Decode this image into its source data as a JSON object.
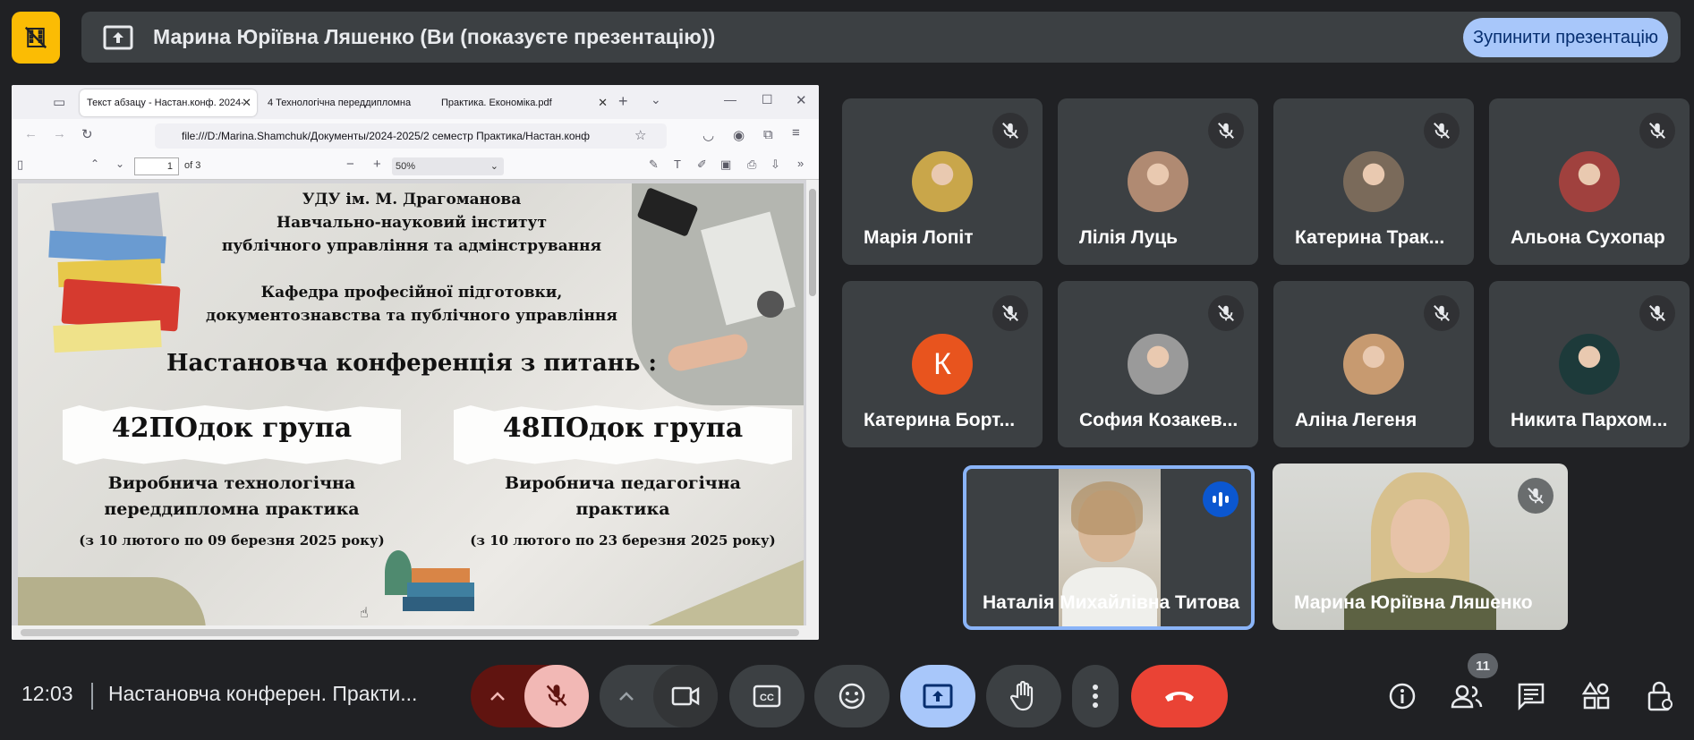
{
  "top": {
    "presenter_text": "Марина Юріївна Ляшенко (Ви (показуєте презентацію))",
    "stop_button_label": "Зупинити презентацію",
    "logo_icon": "film-off-icon",
    "present_icon": "present-to-all-icon"
  },
  "browser": {
    "tabs": [
      {
        "label": "Текст абзацу - Настан.конф. 2024-"
      },
      {
        "label": "4 Технологічна переддипломна"
      },
      {
        "label": "Практика. Економіка.pdf"
      }
    ],
    "url": "file:///D:/Marina.Shamchuk/Документы/2024-2025/2 семестр Практика/Настан.конф",
    "pdf": {
      "page_number": "1",
      "page_total": "of 3",
      "zoom": "50%"
    }
  },
  "slide": {
    "line1": "УДУ ім. М. Драгоманова",
    "line2": "Навчально-науковий інститут",
    "line3": "публічного управління та адмінстрування",
    "line4": "Кафедра професійної підготовки,",
    "line5": "документознавства та публічного управління",
    "heading": "Настановча конференція з питань :",
    "left_group": "42ПОдок група",
    "left_practice_1": "Виробнича технологічна",
    "left_practice_2": "переддипломна практика",
    "left_dates": "(з 10 лютого по 09 березня 2025 року)",
    "right_group": "48ПОдок група",
    "right_practice_1": "Виробнича педагогічна",
    "right_practice_2": "практика",
    "right_dates": "(з 10 лютого по 23 березня 2025 року)"
  },
  "participants": [
    {
      "name": "Марія Лопіт",
      "avatar_color": "#c9a64a"
    },
    {
      "name": "Лілія Луць",
      "avatar_color": "#b08a72"
    },
    {
      "name": "Катерина Трак...",
      "avatar_color": "#7a6a5a"
    },
    {
      "name": "Альона Сухопар",
      "avatar_color": "#a0413e"
    },
    {
      "name": "Катерина Борт...",
      "avatar_letter": "К",
      "avatar_color": "#e8541e"
    },
    {
      "name": "София Козакев...",
      "avatar_color": "#9a9a9a"
    },
    {
      "name": "Аліна Легеня",
      "avatar_color": "#c79a70"
    },
    {
      "name": "Никита Пархом...",
      "avatar_color": "#1d3a3a"
    },
    {
      "name": "Наталія Михайлівна Титова",
      "speaking": true
    },
    {
      "name": "Марина Юріївна Ляшенко"
    }
  ],
  "bottom": {
    "time": "12:03",
    "meeting_title": "Настановча конферен. Практи...",
    "people_count": "11",
    "colors": {
      "end_call": "#ea4335",
      "present_active": "#a8c7fa",
      "mic_off": "#f2b8b5",
      "mic_container": "#601410"
    }
  }
}
